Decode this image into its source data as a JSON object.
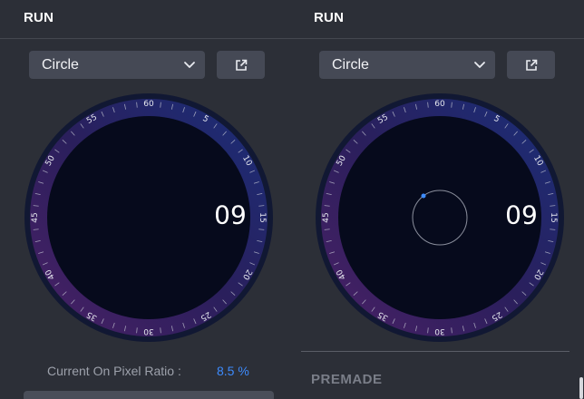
{
  "panels": [
    {
      "title": "RUN",
      "select": {
        "value": "Circle"
      },
      "dial": {
        "ticks": [
          "60",
          "5",
          "10",
          "15",
          "20",
          "25",
          "30",
          "35",
          "40",
          "45",
          "50",
          "55"
        ],
        "readout": "09",
        "has_inner_circle": false
      },
      "ratio": {
        "label": "Current On Pixel Ratio :",
        "value": "8.5 %"
      }
    },
    {
      "title": "RUN",
      "select": {
        "value": "Circle"
      },
      "dial": {
        "ticks": [
          "60",
          "5",
          "10",
          "15",
          "20",
          "25",
          "30",
          "35",
          "40",
          "45",
          "50",
          "55"
        ],
        "readout": "09",
        "has_inner_circle": true
      },
      "section": {
        "label": "PREMADE"
      }
    }
  ],
  "icons": {
    "dropdown": "chevron-down-icon",
    "external": "external-link-icon"
  },
  "colors": {
    "background": "#2c2f37",
    "control": "#454955",
    "accent_blue": "#3d8bfd",
    "dial_face": "#060a1c",
    "ring_blue": "#1a2f7a",
    "ring_purple": "#4a2066"
  }
}
